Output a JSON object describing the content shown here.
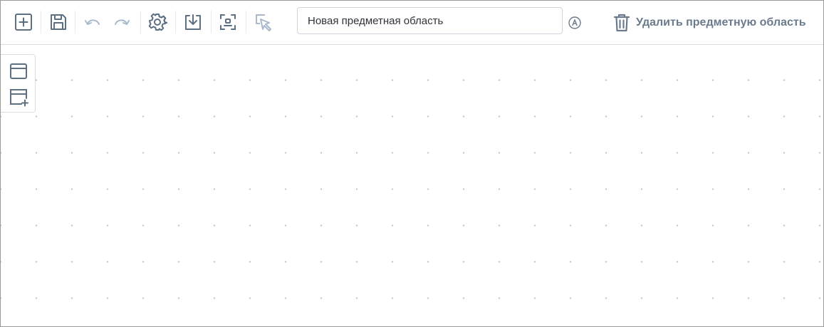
{
  "toolbar": {
    "tools": [
      {
        "icon": "add-icon",
        "enabled": true
      },
      {
        "icon": "save-icon",
        "enabled": true
      },
      {
        "icon": "undo-icon",
        "enabled": false
      },
      {
        "icon": "redo-icon",
        "enabled": false
      },
      {
        "icon": "settings-icon",
        "enabled": true
      },
      {
        "icon": "download-icon",
        "enabled": true
      },
      {
        "icon": "fit-to-screen-icon",
        "enabled": true
      },
      {
        "icon": "select-cursor-icon",
        "enabled": false
      }
    ],
    "name_input": {
      "value": "Новая предметная область"
    },
    "auto_badge_icon": "circled-a-icon",
    "delete_button": {
      "icon": "trash-icon",
      "label": "Удалить предметную область"
    }
  },
  "side_panel": {
    "items": [
      {
        "icon": "entity-icon"
      },
      {
        "icon": "add-entity-icon"
      }
    ]
  },
  "colors": {
    "icon_active": "#5d6f82",
    "icon_disabled": "#a9b9cb",
    "border": "#d8dde3",
    "grid_dot": "#c8ccd1",
    "delete_text": "#6b7b8d"
  }
}
